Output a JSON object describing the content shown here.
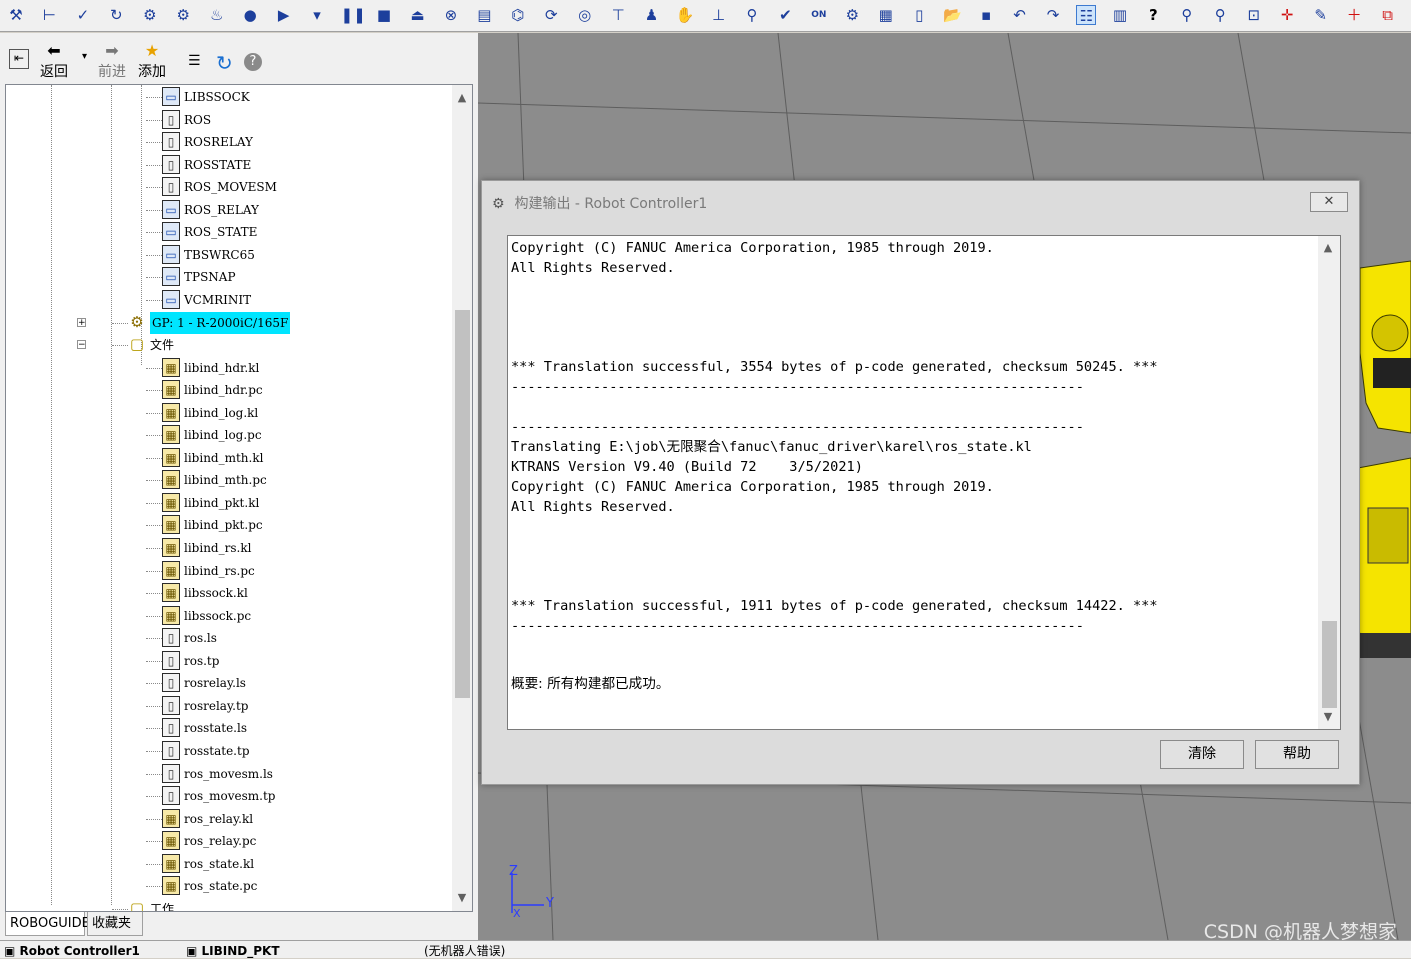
{
  "toolbar": {
    "icons": [
      "tool-dropdown-icon",
      "frame-icon",
      "frame-check-icon",
      "move-to-icon",
      "robot-multi-icon",
      "robot-group-icon",
      "fire-icon",
      "record-icon",
      "play-icon",
      "play-dropdown-icon",
      "pause-icon",
      "stop-icon",
      "eject-icon",
      "abort-icon",
      "program-icon",
      "robot-controller-icon",
      "sync-icon",
      "target-icon",
      "pin-icon",
      "user-icon",
      "hand-icon",
      "measure-icon",
      "iteach-icon",
      "program-check-icon",
      "online-icon",
      "config-icon",
      "grid-icon",
      "document-icon",
      "open-folder-icon",
      "save-icon",
      "undo-icon",
      "redo-icon",
      "cell-browser-icon",
      "chart-icon",
      "help-icon",
      "zoom-icon",
      "zoom-out-icon",
      "zoom-window-icon",
      "move-icon",
      "draw-icon",
      "add-icon",
      "split-icon"
    ]
  },
  "nav": {
    "back_label": "返回",
    "forward_label": "前进",
    "add_label": "添加"
  },
  "tree": {
    "items": [
      {
        "label": "LIBSSOCK",
        "icon": "comp"
      },
      {
        "label": "ROS",
        "icon": "can"
      },
      {
        "label": "ROSRELAY",
        "icon": "can"
      },
      {
        "label": "ROSSTATE",
        "icon": "can"
      },
      {
        "label": "ROS_MOVESM",
        "icon": "can"
      },
      {
        "label": "ROS_RELAY",
        "icon": "comp"
      },
      {
        "label": "ROS_STATE",
        "icon": "comp"
      },
      {
        "label": "TBSWRC65",
        "icon": "comp"
      },
      {
        "label": "TPSNAP",
        "icon": "comp"
      },
      {
        "label": "VCMRINIT",
        "icon": "comp"
      }
    ],
    "gp_label": "GP: 1 - R-2000iC/165F",
    "files_label": "文件",
    "files": [
      {
        "label": "libind_hdr.kl",
        "icon": "bld"
      },
      {
        "label": "libind_hdr.pc",
        "icon": "bld"
      },
      {
        "label": "libind_log.kl",
        "icon": "bld"
      },
      {
        "label": "libind_log.pc",
        "icon": "bld"
      },
      {
        "label": "libind_mth.kl",
        "icon": "bld"
      },
      {
        "label": "libind_mth.pc",
        "icon": "bld"
      },
      {
        "label": "libind_pkt.kl",
        "icon": "bld"
      },
      {
        "label": "libind_pkt.pc",
        "icon": "bld"
      },
      {
        "label": "libind_rs.kl",
        "icon": "bld"
      },
      {
        "label": "libind_rs.pc",
        "icon": "bld"
      },
      {
        "label": "libssock.kl",
        "icon": "bld"
      },
      {
        "label": "libssock.pc",
        "icon": "bld"
      },
      {
        "label": "ros.ls",
        "icon": "can"
      },
      {
        "label": "ros.tp",
        "icon": "can"
      },
      {
        "label": "rosrelay.ls",
        "icon": "can"
      },
      {
        "label": "rosrelay.tp",
        "icon": "can"
      },
      {
        "label": "rosstate.ls",
        "icon": "can"
      },
      {
        "label": "rosstate.tp",
        "icon": "can"
      },
      {
        "label": "ros_movesm.ls",
        "icon": "can"
      },
      {
        "label": "ros_movesm.tp",
        "icon": "can"
      },
      {
        "label": "ros_relay.kl",
        "icon": "bld"
      },
      {
        "label": "ros_relay.pc",
        "icon": "bld"
      },
      {
        "label": "ros_state.kl",
        "icon": "bld"
      },
      {
        "label": "ros_state.pc",
        "icon": "bld"
      }
    ],
    "last_label": "工作"
  },
  "bottom_tabs": [
    "ROBOGUIDE",
    "收藏夹"
  ],
  "dialog": {
    "title": "构建输出 - Robot Controller1",
    "lines": [
      "Copyright (C) FANUC America Corporation, 1985 through 2019.",
      "All Rights Reserved.",
      "",
      "",
      "",
      "",
      "*** Translation successful, 3554 bytes of p-code generated, checksum 50245. ***",
      "----------------------------------------------------------------------",
      "",
      "----------------------------------------------------------------------",
      "Translating E:\\job\\无限聚合\\fanuc\\fanuc_driver\\karel\\ros_state.kl",
      "KTRANS Version V9.40 (Build 72    3/5/2021)",
      "Copyright (C) FANUC America Corporation, 1985 through 2019.",
      "All Rights Reserved.",
      "",
      "",
      "",
      "",
      "*** Translation successful, 1911 bytes of p-code generated, checksum 14422. ***",
      "----------------------------------------------------------------------",
      "",
      "概要: 所有构建都已成功。"
    ],
    "clear_label": "清除",
    "help_label": "帮助"
  },
  "viewport": {
    "axis_z": "Z",
    "axis_y": "Y",
    "axis_x": "X",
    "watermark": "CSDN @机器人梦想家"
  },
  "status_bar": {
    "controller": "Robot Controller1",
    "program": "LIBIND_PKT",
    "message": "(无机器人错误)"
  },
  "colors": {
    "selection": "#00e5ff",
    "robot": "#f5e400",
    "view_bg": "#8c8c8c"
  }
}
